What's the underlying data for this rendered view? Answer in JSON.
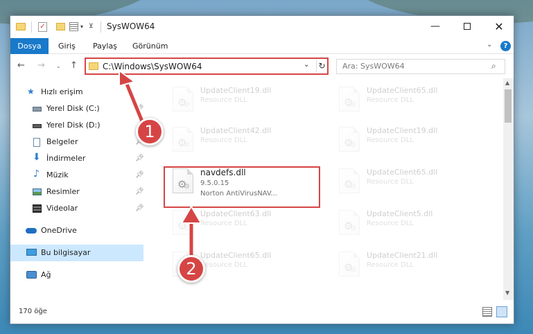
{
  "window": {
    "title": "SysWOW64",
    "controls": {
      "minimize": "—",
      "maximize": "",
      "close": "✕"
    }
  },
  "ribbon": {
    "tabs": [
      {
        "label": "Dosya"
      },
      {
        "label": "Giriş"
      },
      {
        "label": "Paylaş"
      },
      {
        "label": "Görünüm"
      }
    ],
    "help": "?"
  },
  "address": {
    "path": "C:\\Windows\\SysWOW64"
  },
  "search": {
    "placeholder": "Ara: SysWOW64"
  },
  "sidebar": {
    "items": [
      {
        "label": "Hızlı erişim",
        "pinned": false
      },
      {
        "label": "Yerel Disk (C:)",
        "pinned": true
      },
      {
        "label": "Yerel Disk (D:)",
        "pinned": false
      },
      {
        "label": "Belgeler",
        "pinned": true
      },
      {
        "label": "İndirmeler",
        "pinned": true
      },
      {
        "label": "Müzik",
        "pinned": true
      },
      {
        "label": "Resimler",
        "pinned": true
      },
      {
        "label": "Videolar",
        "pinned": true
      },
      {
        "label": "OneDrive",
        "pinned": false
      },
      {
        "label": "Bu bilgisayar",
        "pinned": false,
        "selected": true
      },
      {
        "label": "Ağ",
        "pinned": false
      }
    ]
  },
  "files": [
    {
      "name": "UpdateClient19.dll",
      "type": "Resource DLL",
      "faded": true
    },
    {
      "name": "UpdateClient65.dll",
      "type": "Resource DLL",
      "faded": true
    },
    {
      "name": "UpdateClient42.dll",
      "type": "Resource DLL",
      "faded": true
    },
    {
      "name": "UpdateClient19.dll",
      "type": "Resource DLL",
      "faded": true
    },
    {
      "name": "navdefs.dll",
      "version": "9.5.0.15",
      "type": "Norton AntiVirusNAV...",
      "faded": false
    },
    {
      "name": "UpdateClient65.dll",
      "type": "Resource DLL",
      "faded": true
    },
    {
      "name": "UpdateClient63.dll",
      "type": "Resource DLL",
      "faded": true
    },
    {
      "name": "UpdateClient5.dll",
      "type": "Resource DLL",
      "faded": true
    },
    {
      "name": "UpdateClient65.dll",
      "type": "Resource DLL",
      "faded": true
    },
    {
      "name": "UpdateClient21.dll",
      "type": "Resource DLL",
      "faded": true
    }
  ],
  "status": {
    "count": "170 öğe"
  },
  "annotations": {
    "step1": "1",
    "step2": "2",
    "color": "#d64545"
  }
}
